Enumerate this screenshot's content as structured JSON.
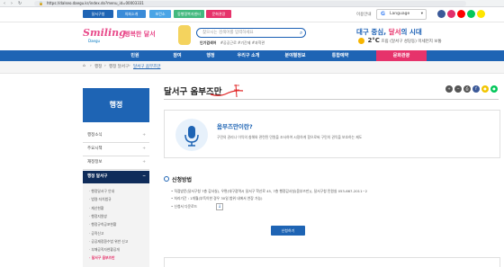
{
  "browser": {
    "url": "https://dalseo.daegu.kr/index.do?menu_id=00003331"
  },
  "utilbar": {
    "tabs": [
      {
        "label": "달서구청",
        "color": "#1e64b4"
      },
      {
        "label": "의회소개",
        "color": "#3a8bd8"
      },
      {
        "label": "보건소",
        "color": "#4aa5e6"
      },
      {
        "label": "동행정복지센터",
        "color": "#43b97f"
      },
      {
        "label": "문화관광",
        "color": "#e6336b"
      }
    ],
    "login": "이용안내",
    "language": "Language"
  },
  "header": {
    "logo_en": "Smiling",
    "logo_sub": "Daegu",
    "logo_kr": "행복한 달서",
    "search_placeholder": "찾으시는 검색어를 입력하세요",
    "hashtag_label": "인기검색어",
    "hashtags": "#공공근로 #기간제 #과학관",
    "slogan_a": "대구 중심,",
    "slogan_b": "달서",
    "slogan_c": "의 시대",
    "temp": "2°C",
    "weather_desc": "흐림 (달서구 성당동) 미세먼지 보통"
  },
  "gnb": {
    "items": [
      "민원",
      "참여",
      "행정",
      "우리구 소개",
      "분야별정보",
      "통합예약"
    ],
    "highlight": "문화관광"
  },
  "breadcrumb": {
    "items": [
      "행정",
      "행정 달서구",
      "달서구 옴부즈만"
    ]
  },
  "sidebar": {
    "title": "행정",
    "menus": [
      "행정소식",
      "주요시책",
      "재정정보"
    ],
    "active": "행정 달서구",
    "subs": [
      "행정달서구 안내",
      "법령·자치법규",
      "재산현황",
      "행정지원방",
      "행정규칙공포현황",
      "공직신고",
      "공공재정환수법 위반 신고",
      "부패공직자현황공개",
      "달서구 옴부즈만"
    ]
  },
  "content": {
    "title": "달서구 옴부즈만",
    "info_title": "옴부즈만이란?",
    "info_desc": "구민의 권리나 이익의 침해와 관련된 민원을 조사하여 시정하게 함으로써 구민의 권익을 보호하는 제도",
    "apply_heading": "신청방법",
    "bullets": [
      "직접방문(달서구청 7층 감사실), 우편(대구광역시 달서구 학산로 45, 7층 행정감사실(옴부즈만)), 달서구청 민원실 053-667-2011~2",
      "처리기간 : 1개월(부득이한 경우 30일 범위 내에서 연장 가능)",
      "신청서 다운로드"
    ],
    "apply_button": "신청하기"
  }
}
